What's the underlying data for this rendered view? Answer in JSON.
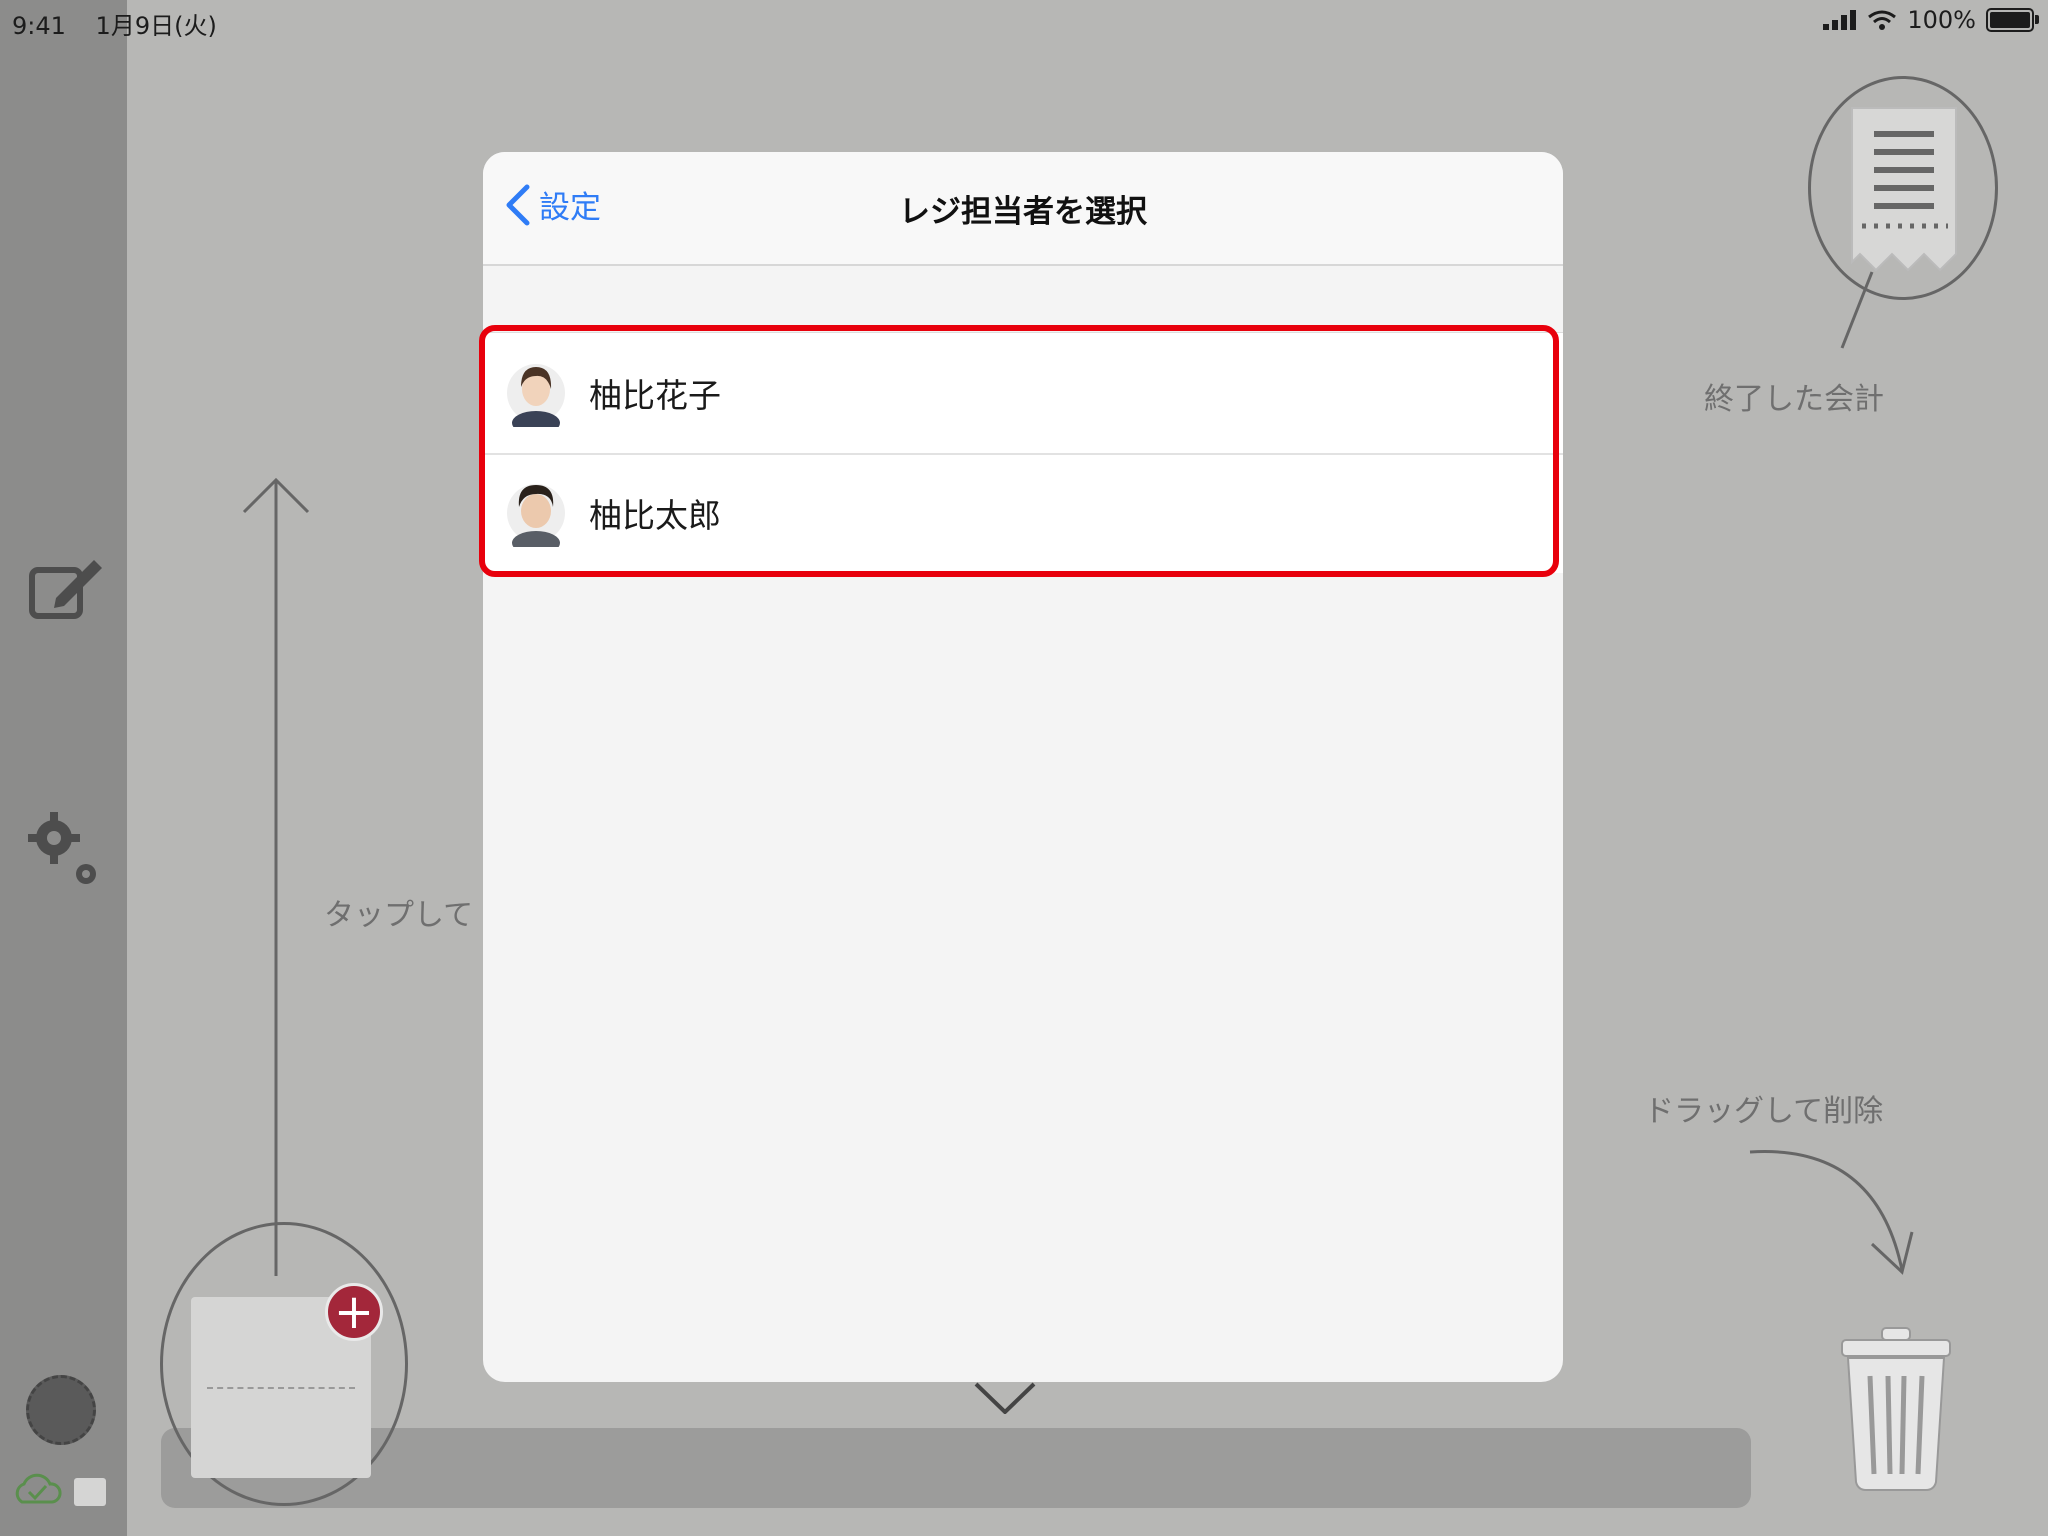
{
  "status_bar": {
    "time": "9:41",
    "date": "1月9日(火)",
    "battery_text": "100%"
  },
  "background": {
    "completed_label": "終了した会計",
    "tap_hint": "タップして",
    "drag_delete_label": "ドラッグして削除"
  },
  "modal": {
    "back_label": "設定",
    "title": "レジ担当者を選択",
    "staff": [
      {
        "name": "柚比花子",
        "avatar": "female-avatar"
      },
      {
        "name": "柚比太郎",
        "avatar": "male-avatar"
      }
    ]
  },
  "colors": {
    "accent": "#2f7cf6",
    "highlight": "#e8000c",
    "badge": "#a3273a"
  }
}
